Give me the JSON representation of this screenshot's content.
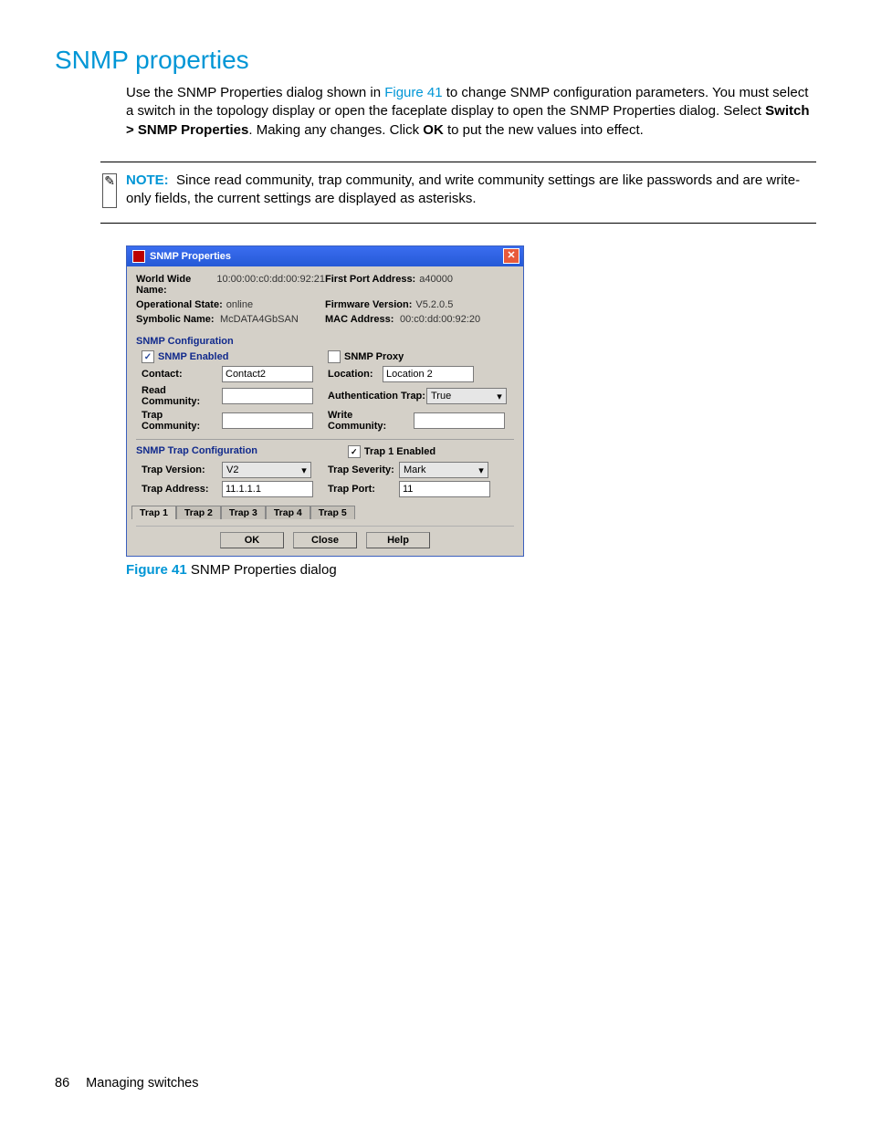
{
  "heading": "SNMP properties",
  "paragraph": {
    "p1": "Use the SNMP Properties dialog shown in ",
    "figref": "Figure 41",
    "p2": " to change SNMP configuration parameters. You must select a switch in the topology display or open the faceplate display to open the SNMP Properties dialog. Select ",
    "menu": "Switch > SNMP Properties",
    "p3": ". Making any changes. Click ",
    "ok": "OK",
    "p4": " to put the new values into effect."
  },
  "note": {
    "label": "NOTE:",
    "text": "Since read community, trap community, and write community settings are like passwords and are write-only fields, the current settings are displayed as asterisks."
  },
  "dialog": {
    "title": "SNMP Properties",
    "info": {
      "wwn_label": "World Wide Name:",
      "wwn_value": "10:00:00:c0:dd:00:92:21",
      "op_label": "Operational State:",
      "op_value": "online",
      "sym_label": "Symbolic Name:",
      "sym_value": "McDATA4GbSAN",
      "fpa_label": "First Port Address:",
      "fpa_value": "a40000",
      "fw_label": "Firmware Version:",
      "fw_value": "V5.2.0.5",
      "mac_label": "MAC Address:",
      "mac_value": "00:c0:dd:00:92:20"
    },
    "snmp_config_header": "SNMP Configuration",
    "snmp_enabled_label": "SNMP Enabled",
    "snmp_proxy_label": "SNMP Proxy",
    "contact_label": "Contact:",
    "contact_value": "Contact2",
    "location_label": "Location:",
    "location_value": "Location 2",
    "read_label": "Read Community:",
    "auth_label": "Authentication Trap:",
    "auth_value": "True",
    "trapc_label": "Trap Community:",
    "writec_label": "Write Community:",
    "trap_config_header": "SNMP Trap Configuration",
    "trap1_enabled_label": "Trap 1 Enabled",
    "trap_version_label": "Trap Version:",
    "trap_version_value": "V2",
    "trap_severity_label": "Trap Severity:",
    "trap_severity_value": "Mark",
    "trap_address_label": "Trap Address:",
    "trap_address_value": "11.1.1.1",
    "trap_port_label": "Trap Port:",
    "trap_port_value": "11",
    "tabs": [
      "Trap 1",
      "Trap 2",
      "Trap 3",
      "Trap 4",
      "Trap 5"
    ],
    "buttons": {
      "ok": "OK",
      "close": "Close",
      "help": "Help"
    }
  },
  "figure_caption": {
    "num": "Figure 41",
    "text": " SNMP Properties dialog"
  },
  "footer": {
    "page": "86",
    "section": "Managing switches"
  }
}
